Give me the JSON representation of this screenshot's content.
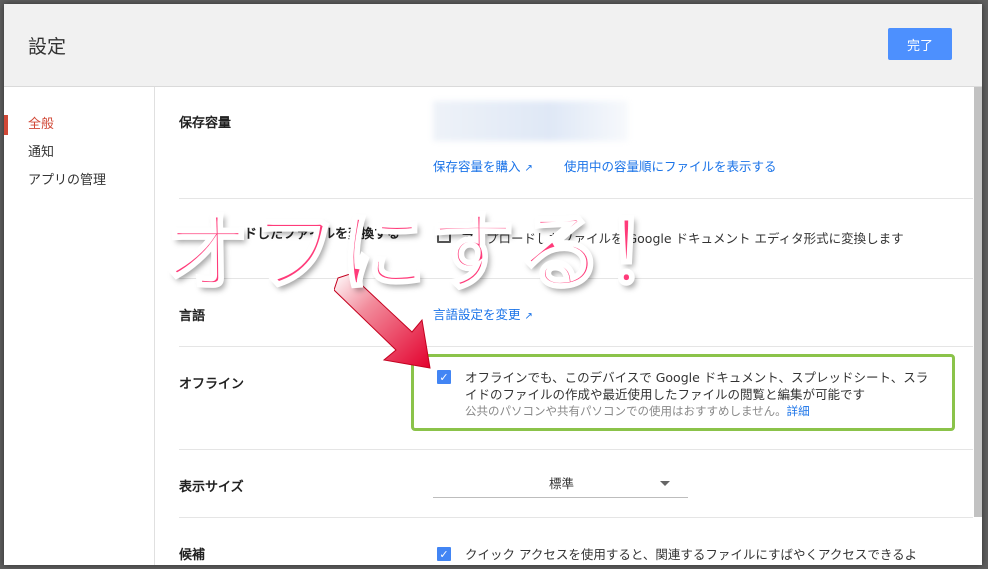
{
  "header": {
    "title": "設定",
    "done_label": "完了"
  },
  "sidebar": {
    "items": [
      {
        "label": "全般",
        "active": true
      },
      {
        "label": "通知",
        "active": false
      },
      {
        "label": "アプリの管理",
        "active": false
      }
    ]
  },
  "settings": {
    "storage": {
      "label": "保存容量",
      "links": [
        "保存容量を購入",
        "使用中の容量順にファイルを表示する"
      ]
    },
    "convert": {
      "label": "アップロードしたファイルを変換する",
      "option": "アップロードしたファイルを Google ドキュメント エディタ形式に変換します",
      "checked": false
    },
    "language": {
      "label": "言語",
      "link": "言語設定を変更"
    },
    "offline": {
      "label": "オフライン",
      "option_line1": "オフラインでも、このデバイスで Google ドキュメント、スプレッドシート、スラ",
      "option_line2": "イドのファイルの作成や最近使用したファイルの閲覧と編集が可能です",
      "note": "公共のパソコンや共有パソコンでの使用はおすすめしません。",
      "note_link": "詳細",
      "checked": true
    },
    "display_size": {
      "label": "表示サイズ",
      "value": "標準"
    },
    "suggestions": {
      "label": "候補",
      "option": "クイック アクセスを使用すると、関連するファイルにすばやくアクセスできるよ",
      "checked": true
    }
  },
  "annotation": {
    "text": "オフにする！",
    "color": "#ff3b7a",
    "highlight_color": "#8bc34a"
  },
  "icons": {
    "external": "external-link-icon",
    "check": "check-icon",
    "dropdown": "chevron-down-icon"
  }
}
